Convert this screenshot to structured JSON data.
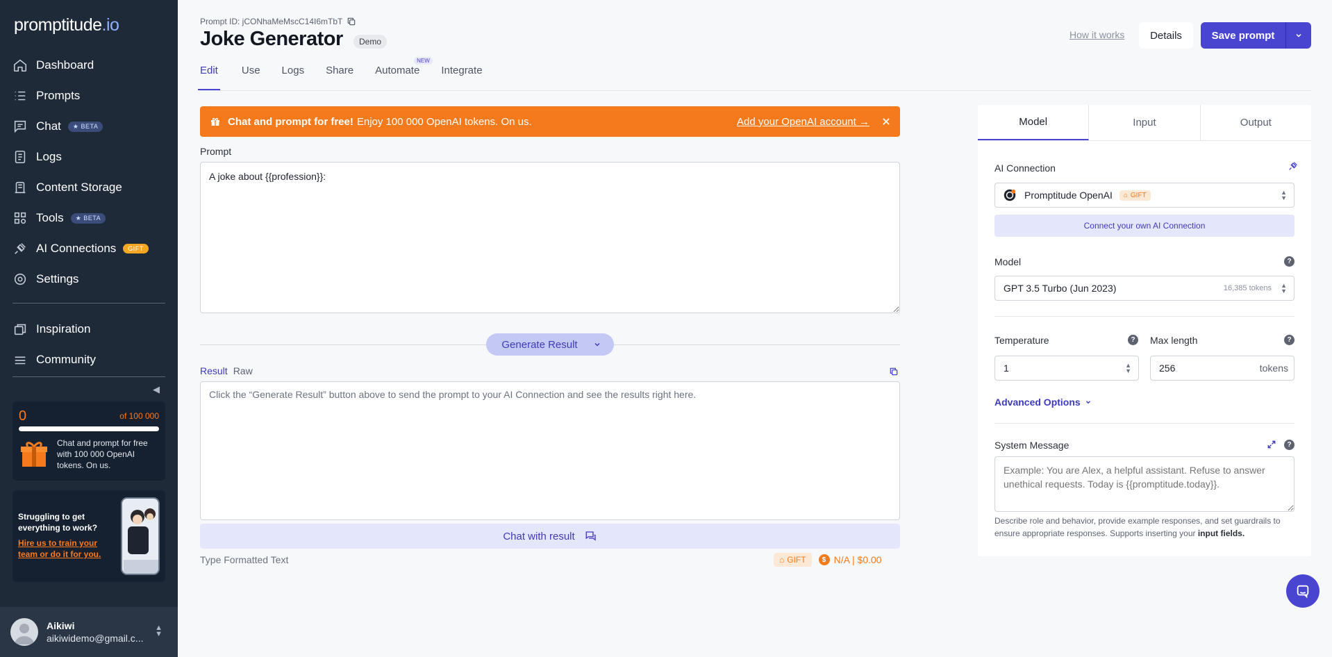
{
  "app": {
    "logo_main": "promptitude",
    "logo_tld": ".io"
  },
  "sidebar": {
    "items": [
      {
        "label": "Dashboard",
        "icon": "home-icon"
      },
      {
        "label": "Prompts",
        "icon": "prompts-icon"
      },
      {
        "label": "Chat",
        "icon": "chat-icon",
        "badge": "BETA"
      },
      {
        "label": "Logs",
        "icon": "logs-icon"
      },
      {
        "label": "Content Storage",
        "icon": "storage-icon"
      },
      {
        "label": "Tools",
        "icon": "tools-icon",
        "badge": "BETA"
      },
      {
        "label": "AI Connections",
        "icon": "plug-icon",
        "badge": "GIFT"
      },
      {
        "label": "Settings",
        "icon": "gear-icon"
      }
    ],
    "secondary": [
      {
        "label": "Inspiration",
        "icon": "inspiration-icon"
      },
      {
        "label": "Community",
        "icon": "community-icon"
      }
    ],
    "tokens": {
      "used": "0",
      "total": "of 100 000",
      "fraction": 0,
      "text": "Chat and prompt for free with 100 000 OpenAI tokens. On us."
    },
    "help": {
      "heading": "Struggling to get everything to work?",
      "link": "Hire us to train your team or do it for you."
    },
    "user": {
      "name": "Aikiwi",
      "email": "aikiwidemo@gmail.c..."
    }
  },
  "header": {
    "prompt_id": "Prompt ID: jCONhaMeMscC14I6mTbT",
    "title": "Joke Generator",
    "badge": "Demo",
    "how_it_works": "How it works",
    "details": "Details",
    "save": "Save prompt",
    "tabs": [
      {
        "label": "Edit",
        "active": true
      },
      {
        "label": "Use"
      },
      {
        "label": "Logs"
      },
      {
        "label": "Share"
      },
      {
        "label": "Automate",
        "badge": "NEW"
      },
      {
        "label": "Integrate"
      }
    ]
  },
  "banner": {
    "bold": "Chat and prompt for free!",
    "text": "Enjoy 100 000 OpenAI tokens. On us.",
    "link": "Add your OpenAI account →",
    "color": "#f57a1c"
  },
  "editor": {
    "prompt_label": "Prompt",
    "prompt_value": "A joke about {{profession}}:",
    "generate": "Generate Result",
    "result_tab": "Result",
    "raw_tab": "Raw",
    "result_placeholder": "Click the “Generate Result” button above to send the prompt to your AI Connection and see the results right here.",
    "chat_with_result": "Chat with result",
    "type": "Type Formatted Text",
    "gift": "GIFT",
    "cost": "N/A | $0.00"
  },
  "panel": {
    "tabs": [
      {
        "label": "Model",
        "active": true
      },
      {
        "label": "Input"
      },
      {
        "label": "Output"
      }
    ],
    "ai_connection_label": "AI Connection",
    "ai_connection_value": "Promptitude OpenAI",
    "ai_connection_badge": "GIFT",
    "connect_own": "Connect your own AI Connection",
    "model_label": "Model",
    "model_value": "GPT 3.5 Turbo (Jun 2023)",
    "model_tokens": "16,385 tokens",
    "temperature_label": "Temperature",
    "temperature_value": "1",
    "max_length_label": "Max length",
    "max_length_value": "256",
    "max_length_unit": "tokens",
    "advanced": "Advanced Options",
    "system_label": "System Message",
    "system_placeholder": "Example: You are Alex, a helpful assistant. Refuse to answer unethical requests. Today is {{promptitude.today}}.",
    "system_desc": "Describe role and behavior, provide example responses, and set guardrails to ensure appropriate responses. Supports inserting your",
    "system_desc_bold": "input fields."
  },
  "colors": {
    "accent": "#4a45d0",
    "sidebar": "#1f2a38",
    "orange": "#f57a1c"
  }
}
